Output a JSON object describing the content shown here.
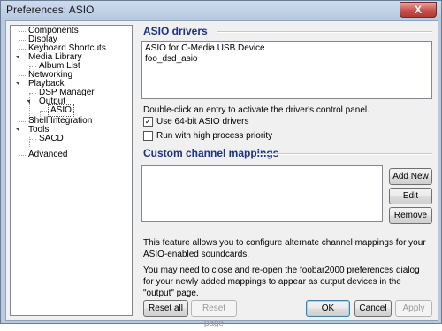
{
  "window": {
    "title": "Preferences: ASIO",
    "close_glyph": "X"
  },
  "tree": {
    "items": [
      {
        "label": "Components"
      },
      {
        "label": "Display"
      },
      {
        "label": "Keyboard Shortcuts"
      },
      {
        "label": "Media Library"
      },
      {
        "label": "Album List"
      },
      {
        "label": "Networking"
      },
      {
        "label": "Playback"
      },
      {
        "label": "DSP Manager"
      },
      {
        "label": "Output"
      },
      {
        "label": "ASIO"
      },
      {
        "label": "Shell Integration"
      },
      {
        "label": "Tools"
      },
      {
        "label": "SACD"
      },
      {
        "label": "Advanced"
      }
    ]
  },
  "asio_drivers": {
    "title": "ASIO drivers",
    "drivers": [
      "ASIO for C-Media USB Device",
      "foo_dsd_asio"
    ],
    "hint": "Double-click an entry to activate the driver's control panel.",
    "use_64bit": {
      "label": "Use 64-bit ASIO drivers",
      "checked": true
    },
    "high_priority": {
      "label": "Run with high process priority",
      "checked": false
    }
  },
  "custom_mappings": {
    "title": "Custom channel mappings",
    "add_label": "Add New",
    "edit_label": "Edit",
    "remove_label": "Remove",
    "info1": "This feature allows you to configure alternate channel mappings for your ASIO-enabled soundcards.",
    "info2": "You may need to close and re-open the foobar2000 preferences dialog for your newly added mappings to appear as output devices in the \"output\" page."
  },
  "buttons": {
    "reset_all": "Reset all",
    "reset_page": "Reset page",
    "ok": "OK",
    "cancel": "Cancel",
    "apply": "Apply"
  },
  "colors": {
    "section_title": "#1e3287",
    "accent": "#3c7fb1"
  }
}
